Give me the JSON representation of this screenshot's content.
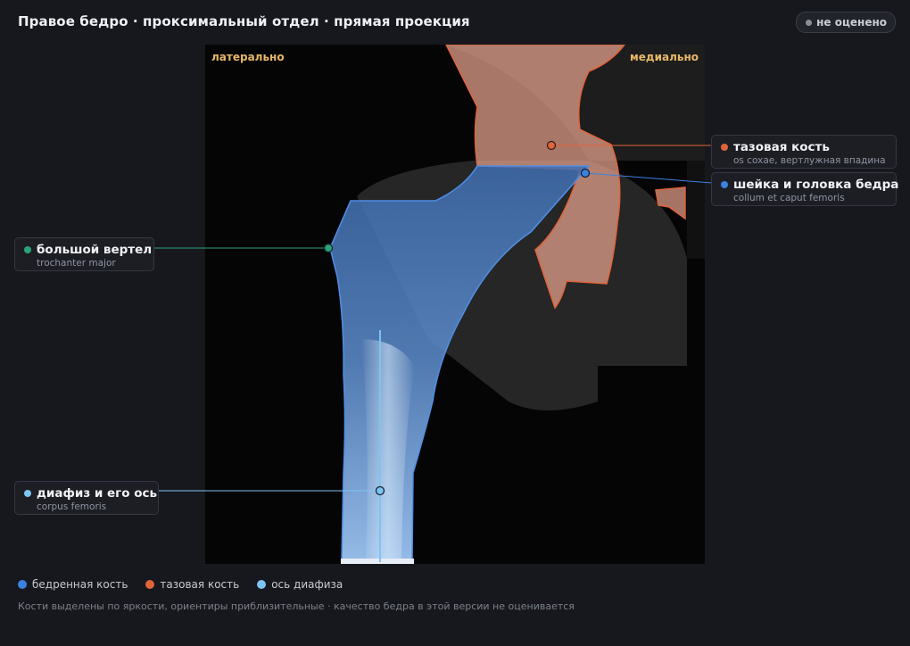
{
  "header": {
    "title": "Правое бедро · проксимальный отдел · прямая проекция",
    "status_label": "не оценено"
  },
  "viewer": {
    "orient_left": "латерально",
    "orient_right": "медиально"
  },
  "labels": {
    "pelvis": {
      "name": "тазовая кость",
      "latin": "os coxae, вертлужная впадина",
      "color": "#e0643a"
    },
    "neck": {
      "name": "шейка и головка бедра",
      "latin": "collum et caput femoris",
      "color": "#3b82e0"
    },
    "trochanter": {
      "name": "большой вертел",
      "latin": "trochanter major",
      "color": "#2aa37a"
    },
    "shaft": {
      "name": "диафиз и его ось",
      "latin": "corpus femoris",
      "color": "#7cc4f2"
    }
  },
  "legend": [
    {
      "label": "бедренная кость",
      "color": "#3b82e0"
    },
    {
      "label": "тазовая кость",
      "color": "#e0643a"
    },
    {
      "label": "ось диафиза",
      "color": "#7cc4f2"
    }
  ],
  "footnote": "Кости выделены по яркости, ориентиры приблизительные · качество бедра в этой версии не оценивается"
}
